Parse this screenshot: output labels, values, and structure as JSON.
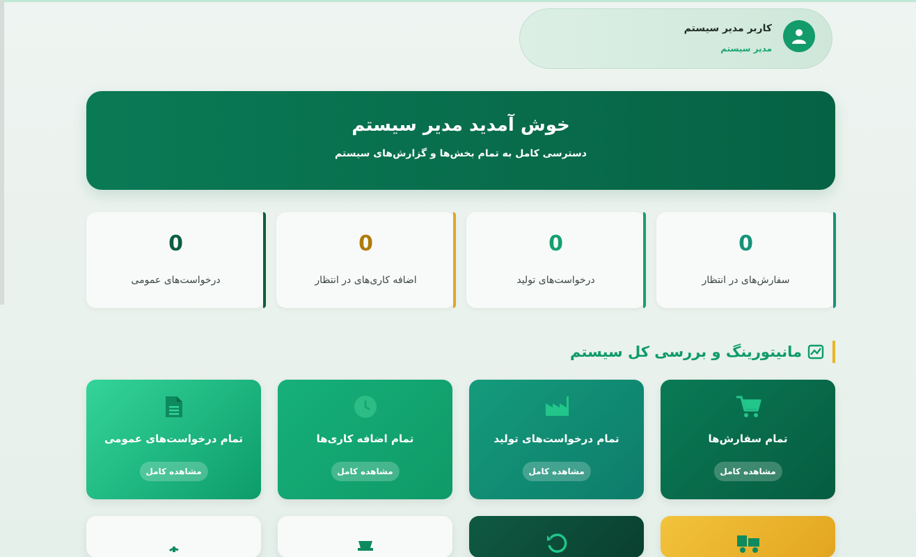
{
  "user": {
    "name": "کاربر مدیر سیستم",
    "role": "مدیر سیستم",
    "avatar_icon": "user-icon"
  },
  "welcome": {
    "title": "خوش آمدید مدیر سیستم",
    "subtitle": "دسترسی کامل به تمام بخش‌ها و گزارش‌های سیستم"
  },
  "stats": [
    {
      "value": "0",
      "label": "سفارش‌های در انتظار",
      "color": "#15937a"
    },
    {
      "value": "0",
      "label": "درخواست‌های تولید",
      "color": "#16a06f"
    },
    {
      "value": "0",
      "label": "اضافه کاری‌های در انتظار",
      "color": "#b07b0c"
    },
    {
      "value": "0",
      "label": "درخواست‌های عمومی",
      "color": "#0c5e3f"
    }
  ],
  "section": {
    "title": "مانیتورینگ و بررسی کل سیستم",
    "icon": "chart-line-icon"
  },
  "modules": [
    {
      "title": "تمام سفارش‌ها",
      "button": "مشاهده کامل",
      "icon": "cart-icon",
      "color": "#086b48"
    },
    {
      "title": "تمام درخواست‌های تولید",
      "button": "مشاهده کامل",
      "icon": "factory-icon",
      "color": "#138a73"
    },
    {
      "title": "تمام اضافه کاری‌ها",
      "button": "مشاهده کامل",
      "icon": "clock-icon",
      "color": "#12a872"
    },
    {
      "title": "تمام درخواست‌های عمومی",
      "button": "مشاهده کامل",
      "icon": "document-icon",
      "color": "#22c28c"
    }
  ],
  "bottom_modules": [
    {
      "icon": "truck-icon",
      "color": "#ebb52a"
    },
    {
      "icon": "history-icon",
      "color": "#0d4f3a"
    },
    {
      "icon": "basket-icon",
      "color": "#f7faf8"
    },
    {
      "icon": "dollar-icon",
      "color": "#f7faf8"
    }
  ]
}
